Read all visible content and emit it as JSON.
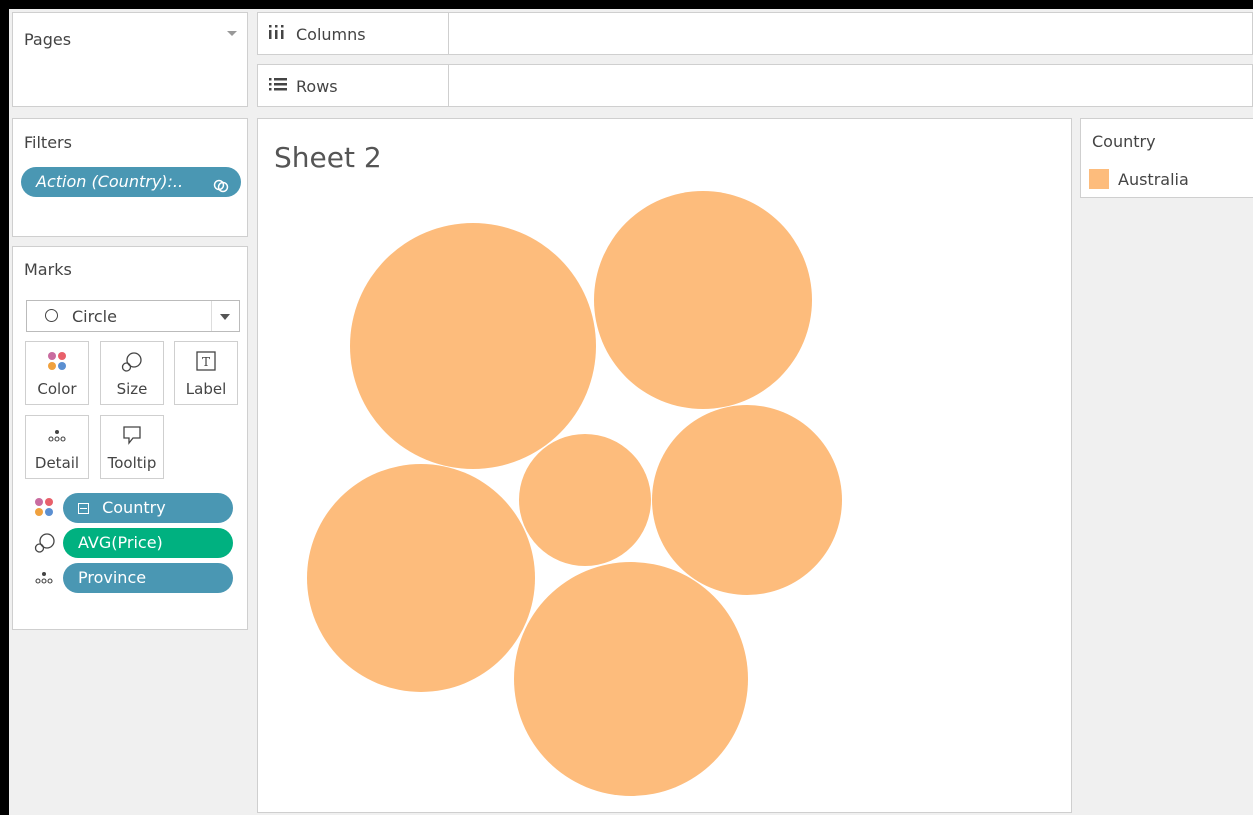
{
  "pages": {
    "title": "Pages"
  },
  "shelves": {
    "columns_label": "Columns",
    "rows_label": "Rows"
  },
  "filters": {
    "title": "Filters",
    "pill_label": "Action (Country):.."
  },
  "marks": {
    "title": "Marks",
    "mark_type": "Circle",
    "buttons": {
      "color": "Color",
      "size": "Size",
      "label": "Label",
      "detail": "Detail",
      "tooltip": "Tooltip"
    },
    "fields": [
      {
        "label": "Country",
        "encoding": "color",
        "pill_color": "#4a97b3"
      },
      {
        "label": "AVG(Price)",
        "encoding": "size",
        "pill_color": "#00b180"
      },
      {
        "label": "Province",
        "encoding": "detail",
        "pill_color": "#4a97b3"
      }
    ]
  },
  "sheet": {
    "title": "Sheet 2"
  },
  "legend": {
    "title": "Country",
    "items": [
      {
        "label": "Australia",
        "color": "#fdbc7c"
      }
    ]
  },
  "chart_data": {
    "type": "packed-bubble",
    "mark_color": "#fdbc7c",
    "bubble_count": 6
  }
}
